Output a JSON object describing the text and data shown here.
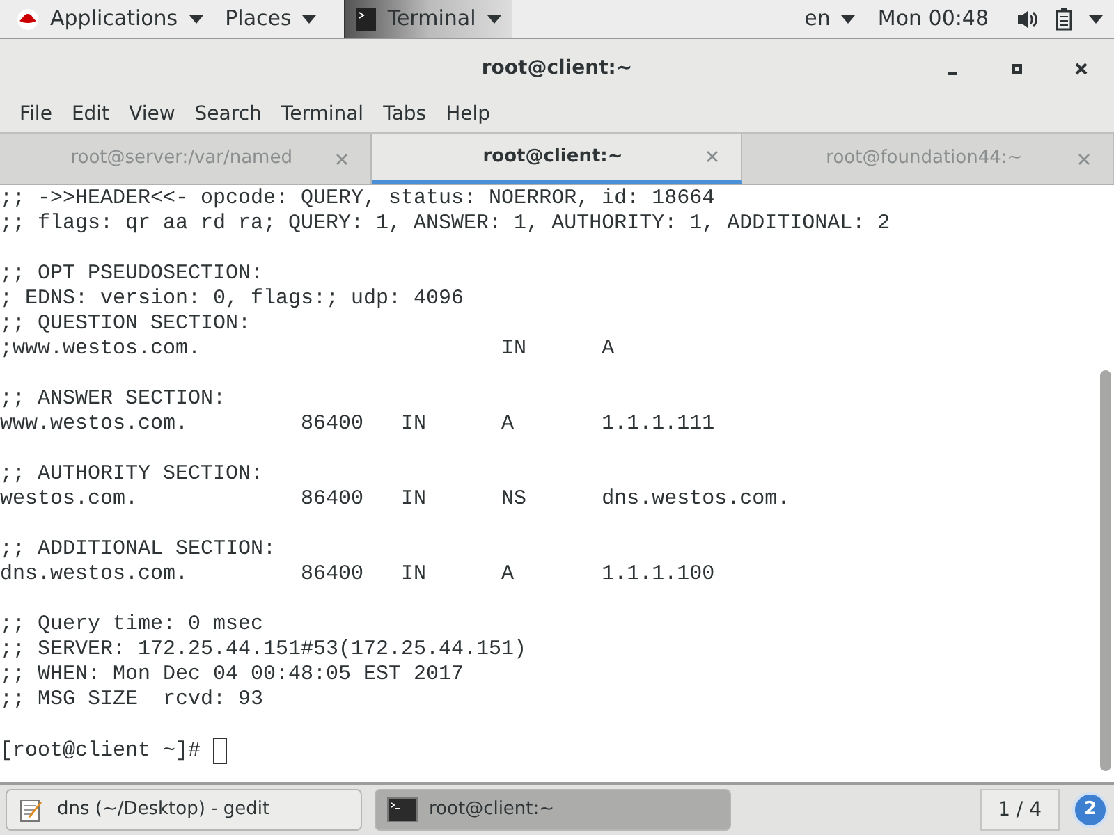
{
  "top_bar": {
    "menus": [
      {
        "label": "Applications",
        "kind": "apps"
      },
      {
        "label": "Places",
        "kind": "plain"
      },
      {
        "label": "Terminal",
        "kind": "app"
      }
    ],
    "language": "en",
    "clock": "Mon 00:48"
  },
  "window": {
    "title": "root@client:~",
    "menu": [
      "File",
      "Edit",
      "View",
      "Search",
      "Terminal",
      "Tabs",
      "Help"
    ],
    "tabs": [
      {
        "label": "root@server:/var/named",
        "selected": false
      },
      {
        "label": "root@client:~",
        "selected": true
      },
      {
        "label": "root@foundation44:~",
        "selected": false
      }
    ],
    "terminal": {
      "blocks": [
        [
          ";; ->>HEADER<<- opcode: QUERY, status: NOERROR, id: 18664",
          ";; flags: qr aa rd ra; QUERY: 1, ANSWER: 1, AUTHORITY: 1, ADDITIONAL: 2"
        ],
        [
          ";; OPT PSEUDOSECTION:",
          "; EDNS: version: 0, flags:; udp: 4096",
          ";; QUESTION SECTION:",
          ";www.westos.com.                        IN      A"
        ],
        [
          ";; ANSWER SECTION:",
          "www.westos.com.         86400   IN      A       1.1.1.111"
        ],
        [
          ";; AUTHORITY SECTION:",
          "westos.com.             86400   IN      NS      dns.westos.com."
        ],
        [
          ";; ADDITIONAL SECTION:",
          "dns.westos.com.         86400   IN      A       1.1.1.100"
        ],
        [
          ";; Query time: 0 msec",
          ";; SERVER: 172.25.44.151#53(172.25.44.151)",
          ";; WHEN: Mon Dec 04 00:48:05 EST 2017",
          ";; MSG SIZE  rcvd: 93"
        ]
      ],
      "prompt": "[root@client ~]#"
    }
  },
  "taskbar": {
    "tasks": [
      {
        "label": "dns (~/Desktop) - gedit",
        "kind": "editor",
        "selected": false
      },
      {
        "label": "root@client:~",
        "kind": "terminal",
        "selected": true
      }
    ],
    "workspace": "1 / 4",
    "notifications": "2"
  }
}
